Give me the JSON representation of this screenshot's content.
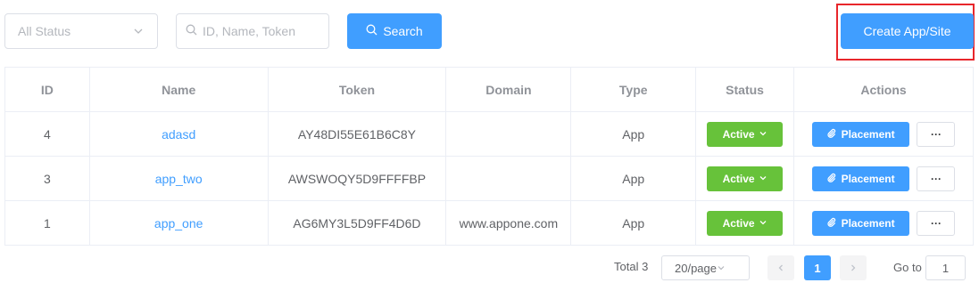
{
  "toolbar": {
    "status_placeholder": "All Status",
    "search_placeholder": "ID, Name, Token",
    "search_label": "Search",
    "create_label": "Create App/Site"
  },
  "table": {
    "headers": {
      "id": "ID",
      "name": "Name",
      "token": "Token",
      "domain": "Domain",
      "type": "Type",
      "status": "Status",
      "actions": "Actions"
    },
    "rows": [
      {
        "id": "4",
        "name": "adasd",
        "token": "AY48DI55E61B6C8Y",
        "domain": "",
        "type": "App",
        "status": "Active",
        "placement": "Placement",
        "more": "···"
      },
      {
        "id": "3",
        "name": "app_two",
        "token": "AWSWOQY5D9FFFFBP",
        "domain": "",
        "type": "App",
        "status": "Active",
        "placement": "Placement",
        "more": "···"
      },
      {
        "id": "1",
        "name": "app_one",
        "token": "AG6MY3L5D9FF4D6D",
        "domain": "www.appone.com",
        "type": "App",
        "status": "Active",
        "placement": "Placement",
        "more": "···"
      }
    ]
  },
  "pagination": {
    "total": "Total 3",
    "page_size": "20/page",
    "current_page": "1",
    "goto_label": "Go to",
    "goto_value": "1"
  },
  "colors": {
    "primary": "#409eff",
    "success": "#67c23a",
    "highlight": "#e8262b"
  },
  "icons": {
    "status_select": "chevron-down-icon",
    "search_input": "search-icon",
    "search_button": "search-icon",
    "status_dropdown": "chevron-down-icon",
    "placement": "paperclip-icon",
    "prev": "chevron-left-icon",
    "next": "chevron-right-icon"
  }
}
